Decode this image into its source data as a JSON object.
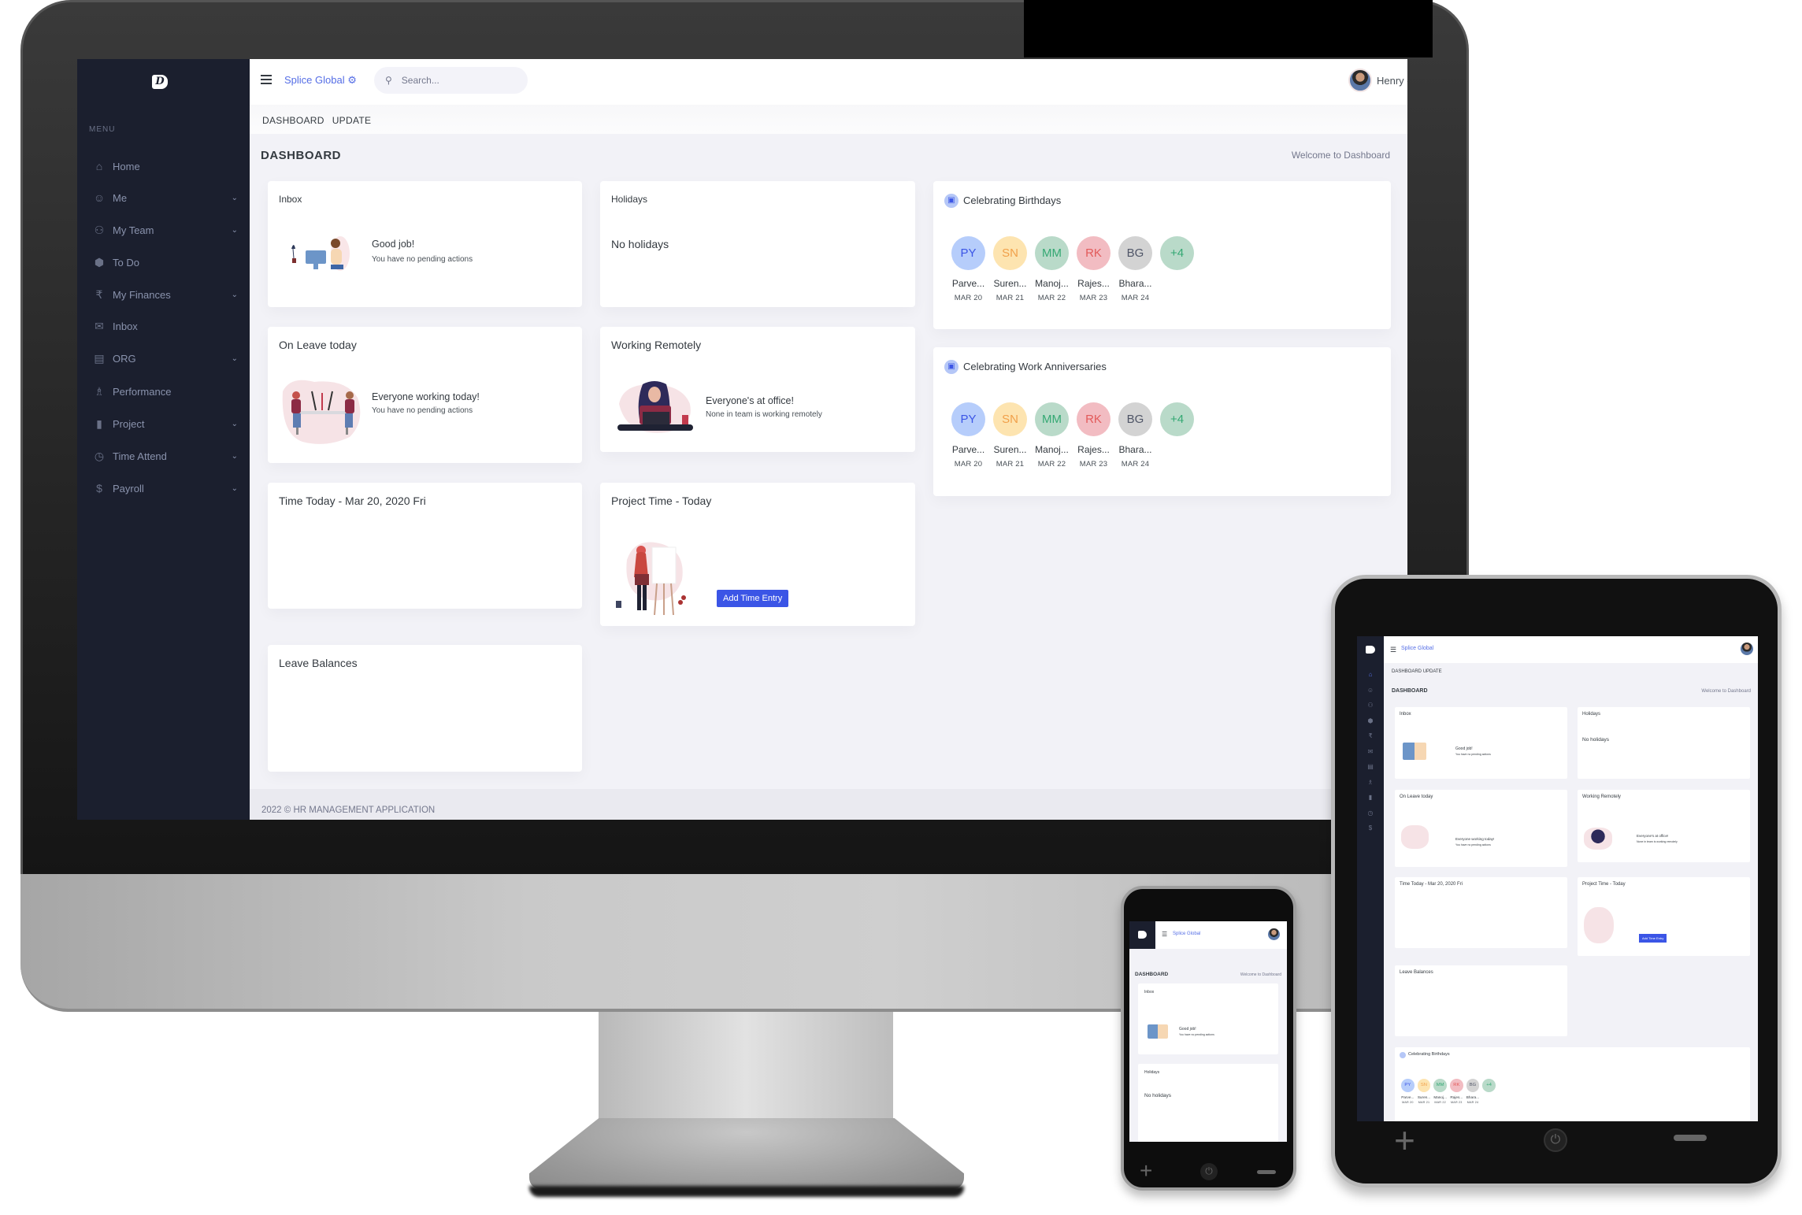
{
  "app": {
    "logo_glyph": "D",
    "brand": "Splice Global",
    "brand_icon": "gear-icon"
  },
  "search": {
    "placeholder": "Search...",
    "icon": "search-icon"
  },
  "user": {
    "name": "Henry",
    "avatar": "user-avatar"
  },
  "breadcrumb": [
    "DASHBOARD",
    "UPDATE"
  ],
  "page": {
    "title": "DASHBOARD",
    "welcome": "Welcome to Dashboard"
  },
  "sidebar": {
    "menu_label": "MENU",
    "items": [
      {
        "label": "Home",
        "icon": "home-icon",
        "has_submenu": false
      },
      {
        "label": "Me",
        "icon": "user-icon",
        "has_submenu": true
      },
      {
        "label": "My Team",
        "icon": "team-icon",
        "has_submenu": true
      },
      {
        "label": "To Do",
        "icon": "box-icon",
        "has_submenu": false
      },
      {
        "label": "My Finances",
        "icon": "rupee-icon",
        "has_submenu": true
      },
      {
        "label": "Inbox",
        "icon": "mail-icon",
        "has_submenu": false
      },
      {
        "label": "ORG",
        "icon": "org-icon",
        "has_submenu": true
      },
      {
        "label": "Performance",
        "icon": "trophy-icon",
        "has_submenu": false
      },
      {
        "label": "Project",
        "icon": "clipboard-icon",
        "has_submenu": true
      },
      {
        "label": "Time Attend",
        "icon": "clock-icon",
        "has_submenu": true
      },
      {
        "label": "Payroll",
        "icon": "payroll-hand-icon",
        "has_submenu": true
      }
    ]
  },
  "cards": {
    "inbox": {
      "title": "Inbox",
      "message": "Good job!",
      "sub": "You have no pending actions"
    },
    "holidays": {
      "title": "Holidays",
      "message": "No holidays"
    },
    "on_leave": {
      "title": "On Leave today",
      "message": "Everyone working today!",
      "sub": "You have no pending actions"
    },
    "remote": {
      "title": "Working Remotely",
      "message": "Everyone's at office!",
      "sub": "None in team is working remotely"
    },
    "time_today": {
      "title": "Time Today - Mar 20, 2020 Fri"
    },
    "project_time": {
      "title": "Project Time - Today",
      "button": "Add Time Entry"
    },
    "leave_balances": {
      "title": "Leave Balances"
    }
  },
  "birthdays": {
    "title": "Celebrating Birthdays",
    "people": [
      {
        "initials": "PY",
        "name": "Parve...",
        "date": "MAR 20",
        "bg": "#b6cdfb",
        "fg": "#3b55e6"
      },
      {
        "initials": "SN",
        "name": "Suren...",
        "date": "MAR 21",
        "bg": "#fde4b0",
        "fg": "#f1a04a"
      },
      {
        "initials": "MM",
        "name": "Manoj...",
        "date": "MAR 22",
        "bg": "#b9dac9",
        "fg": "#34a873"
      },
      {
        "initials": "RK",
        "name": "Rajes...",
        "date": "MAR 23",
        "bg": "#f2bcc2",
        "fg": "#e25a5a"
      },
      {
        "initials": "BG",
        "name": "Bhara...",
        "date": "MAR 24",
        "bg": "#d3d3d3",
        "fg": "#4f5567"
      }
    ],
    "more": {
      "label": "+4",
      "bg": "#b9dac9",
      "fg": "#34a873"
    }
  },
  "anniversaries": {
    "title": "Celebrating Work Anniversaries",
    "people": [
      {
        "initials": "PY",
        "name": "Parve...",
        "date": "MAR 20",
        "bg": "#b6cdfb",
        "fg": "#3b55e6"
      },
      {
        "initials": "SN",
        "name": "Suren...",
        "date": "MAR 21",
        "bg": "#fde4b0",
        "fg": "#f1a04a"
      },
      {
        "initials": "MM",
        "name": "Manoj...",
        "date": "MAR 22",
        "bg": "#b9dac9",
        "fg": "#34a873"
      },
      {
        "initials": "RK",
        "name": "Rajes...",
        "date": "MAR 23",
        "bg": "#f2bcc2",
        "fg": "#e25a5a"
      },
      {
        "initials": "BG",
        "name": "Bhara...",
        "date": "MAR 24",
        "bg": "#d3d3d3",
        "fg": "#4f5567"
      }
    ],
    "more": {
      "label": "+4",
      "bg": "#b9dac9",
      "fg": "#34a873"
    }
  },
  "footer": {
    "text": "2022 © HR MANAGEMENT APPLICATION"
  },
  "device_buttons": {
    "plus": "+",
    "minus": "−",
    "power": "⏻"
  },
  "colors": {
    "accent": "#556ee6",
    "button": "#3b55e6",
    "sidebar_bg": "#1b1f2e",
    "page_bg": "#f2f2f7"
  }
}
